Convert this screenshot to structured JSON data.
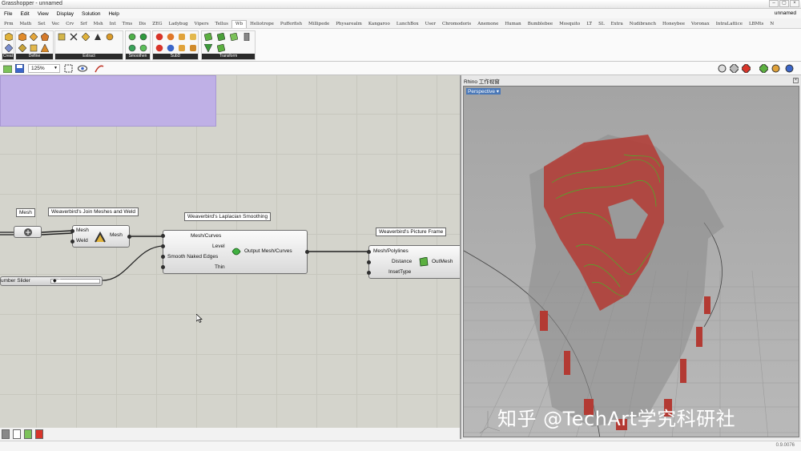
{
  "window": {
    "title": "Grasshopper - unnamed",
    "doc_name": "unnamed",
    "min": "–",
    "max": "▢",
    "close": "×"
  },
  "menu": [
    "File",
    "Edit",
    "View",
    "Display",
    "Solution",
    "Help"
  ],
  "tabs": [
    "Prm",
    "Math",
    "Set",
    "Vec",
    "Crv",
    "Srf",
    "Msh",
    "Int",
    "Trns",
    "Dis",
    "ZEG",
    "Ladybug",
    "Vipers",
    "Tellus",
    "Wb",
    "Heliotrope",
    "Pufferfish",
    "Millipede",
    "Physarealm",
    "Kangaroo",
    "LunchBox",
    "User",
    "Chromodoris",
    "Anemone",
    "Human",
    "Bumblebee",
    "Mosquito",
    "LT",
    "SL",
    "Extra",
    "Nudibranch",
    "Honeybee",
    "Voronax",
    "IntraLattice",
    "LBMts",
    "N"
  ],
  "active_tab": "Wb",
  "ribbon_groups": [
    {
      "label": "Creat",
      "icons": [
        "cube-icon",
        "octahedron-icon"
      ]
    },
    {
      "label": "Define",
      "icons": [
        "box-icon",
        "diamond-icon",
        "dodeca-icon",
        "cross-icon",
        "wire-box-icon",
        "triangle-icon",
        "star-icon",
        "hex-icon"
      ]
    },
    {
      "label": "Extract",
      "icons": [
        "extract-a-icon",
        "extract-b-icon",
        "extract-c-icon",
        "extract-d-icon",
        "extract-e-icon"
      ]
    },
    {
      "label": "Smoothen",
      "icons": [
        "drop-icon",
        "drop-green-icon",
        "drop-blue-icon",
        "drop-teal-icon"
      ]
    },
    {
      "label": "SubD",
      "icons": [
        "sphere-red-icon",
        "sphere-orange-icon",
        "sphere-blue-icon",
        "subd-a-icon",
        "subd-b-icon",
        "subd-c-icon",
        "subd-d-icon",
        "subd-e-icon"
      ]
    },
    {
      "label": "Transform",
      "icons": [
        "frame-icon",
        "frame-b-icon",
        "frame-c-icon",
        "frame-d-icon",
        "frame-e-icon",
        "frame-f-icon"
      ]
    }
  ],
  "toolbar": {
    "zoom": "125%"
  },
  "components": {
    "mesh_param": {
      "label": "Mesh"
    },
    "join": {
      "label": "Weaverbird's Join Meshes and Weld",
      "in1": "Mesh",
      "in2": "Weld",
      "out": "Mesh"
    },
    "laplacian": {
      "label": "Weaverbird's Laplacian Smoothing",
      "in1": "Mesh/Curves",
      "in2": "Level",
      "in3": "Smooth Naked Edges",
      "in4": "Thin",
      "out": "Output Mesh/Curves"
    },
    "picture_frame": {
      "label": "Weaverbird's Picture Frame",
      "in1": "Mesh/Polylines",
      "in2": "Distance",
      "in3": "InsetType",
      "out": "OutMesh"
    },
    "slider": {
      "label": "umber Slider",
      "value": "2"
    }
  },
  "viewport": {
    "title": "Rhino 工作视窗",
    "view": "Perspective"
  },
  "watermark": "知乎 @TechArt学究科研社",
  "status": {
    "version": "0.9.0076"
  },
  "colors": {
    "purple_group": "#bfb0e6",
    "canvas": "#d4d4cc",
    "mesh_red": "#b33a33",
    "mesh_green": "#46b526"
  }
}
